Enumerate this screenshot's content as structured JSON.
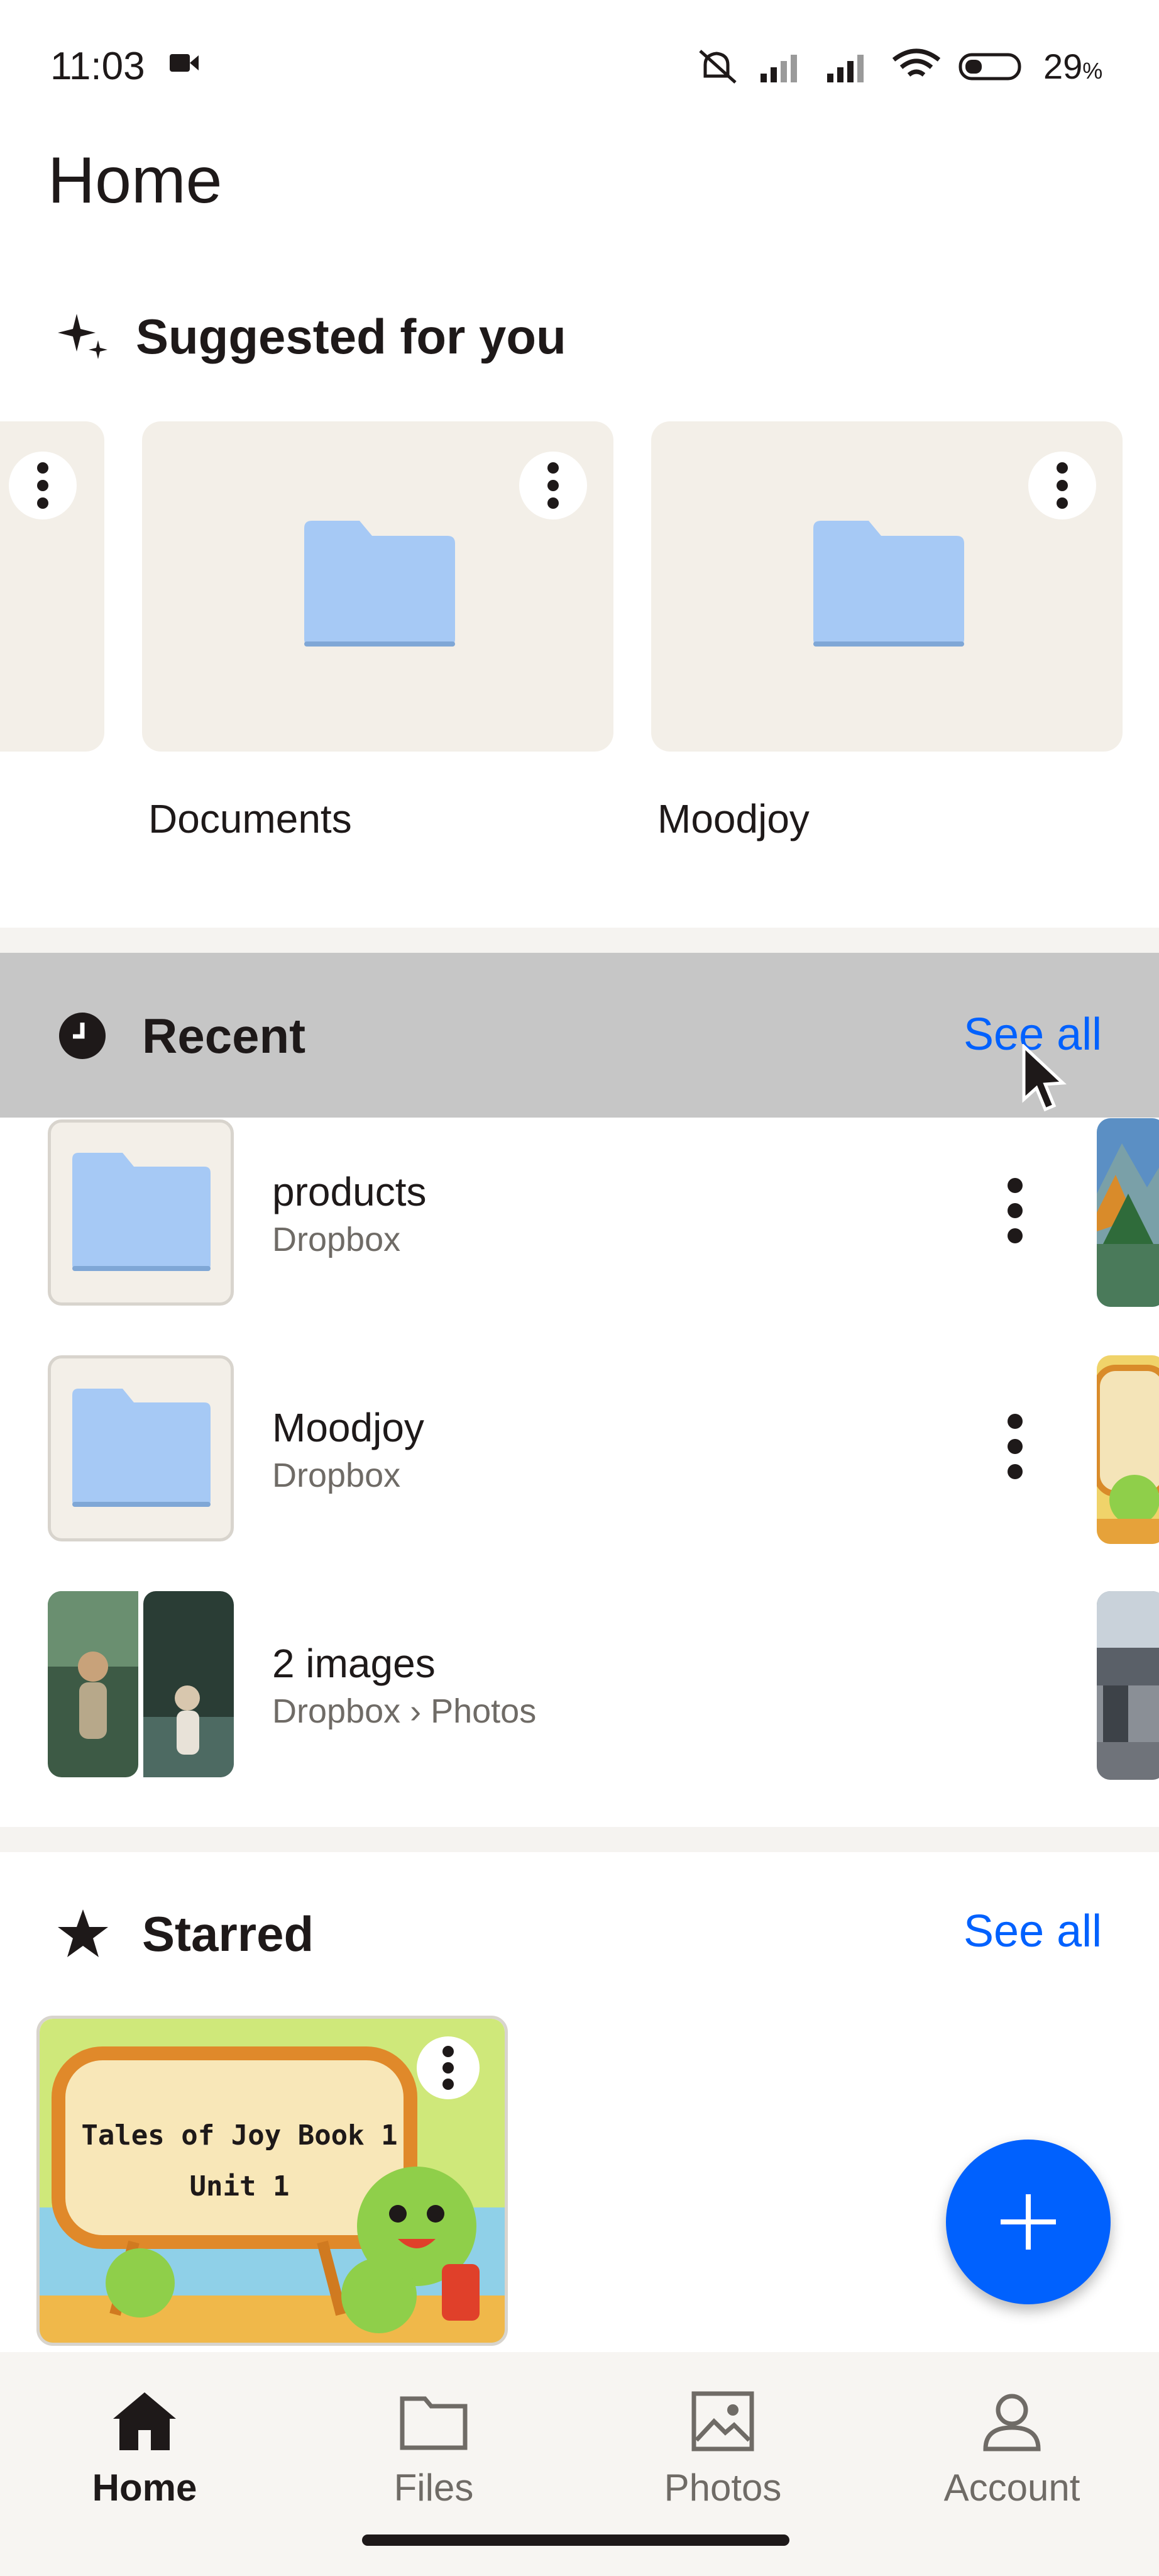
{
  "status_bar": {
    "time": "11:03",
    "battery": "29",
    "battery_unit": "%",
    "icons": [
      "camera-icon",
      "mute-icon",
      "signal-icon",
      "signal-icon",
      "wifi-icon",
      "battery-icon"
    ]
  },
  "page": {
    "title": "Home"
  },
  "suggested": {
    "title": "Suggested for you",
    "icon": "sparkle-icon",
    "cards": [
      {
        "label": ""
      },
      {
        "label": "Documents"
      },
      {
        "label": "Moodjoy"
      }
    ]
  },
  "recent": {
    "title": "Recent",
    "see_all": "See all",
    "items": [
      {
        "name": "products",
        "location": "Dropbox",
        "type": "folder"
      },
      {
        "name": "Moodjoy",
        "location": "Dropbox",
        "type": "folder"
      },
      {
        "name": "2 images",
        "location": "Dropbox › Photos",
        "type": "images"
      }
    ]
  },
  "starred": {
    "title": "Starred",
    "see_all": "See all",
    "card": {
      "line1": "Tales of Joy Book 1",
      "line2": "Unit 1"
    }
  },
  "bottom_nav": [
    {
      "label": "Home",
      "icon": "home-icon",
      "active": true
    },
    {
      "label": "Files",
      "icon": "folder-icon",
      "active": false
    },
    {
      "label": "Photos",
      "icon": "photo-icon",
      "active": false
    },
    {
      "label": "Account",
      "icon": "account-icon",
      "active": false
    }
  ],
  "colors": {
    "accent": "#0061fe",
    "folder": "#a6c9f5",
    "card_bg": "#f3efe8",
    "highlight": "#c6c6c6"
  }
}
